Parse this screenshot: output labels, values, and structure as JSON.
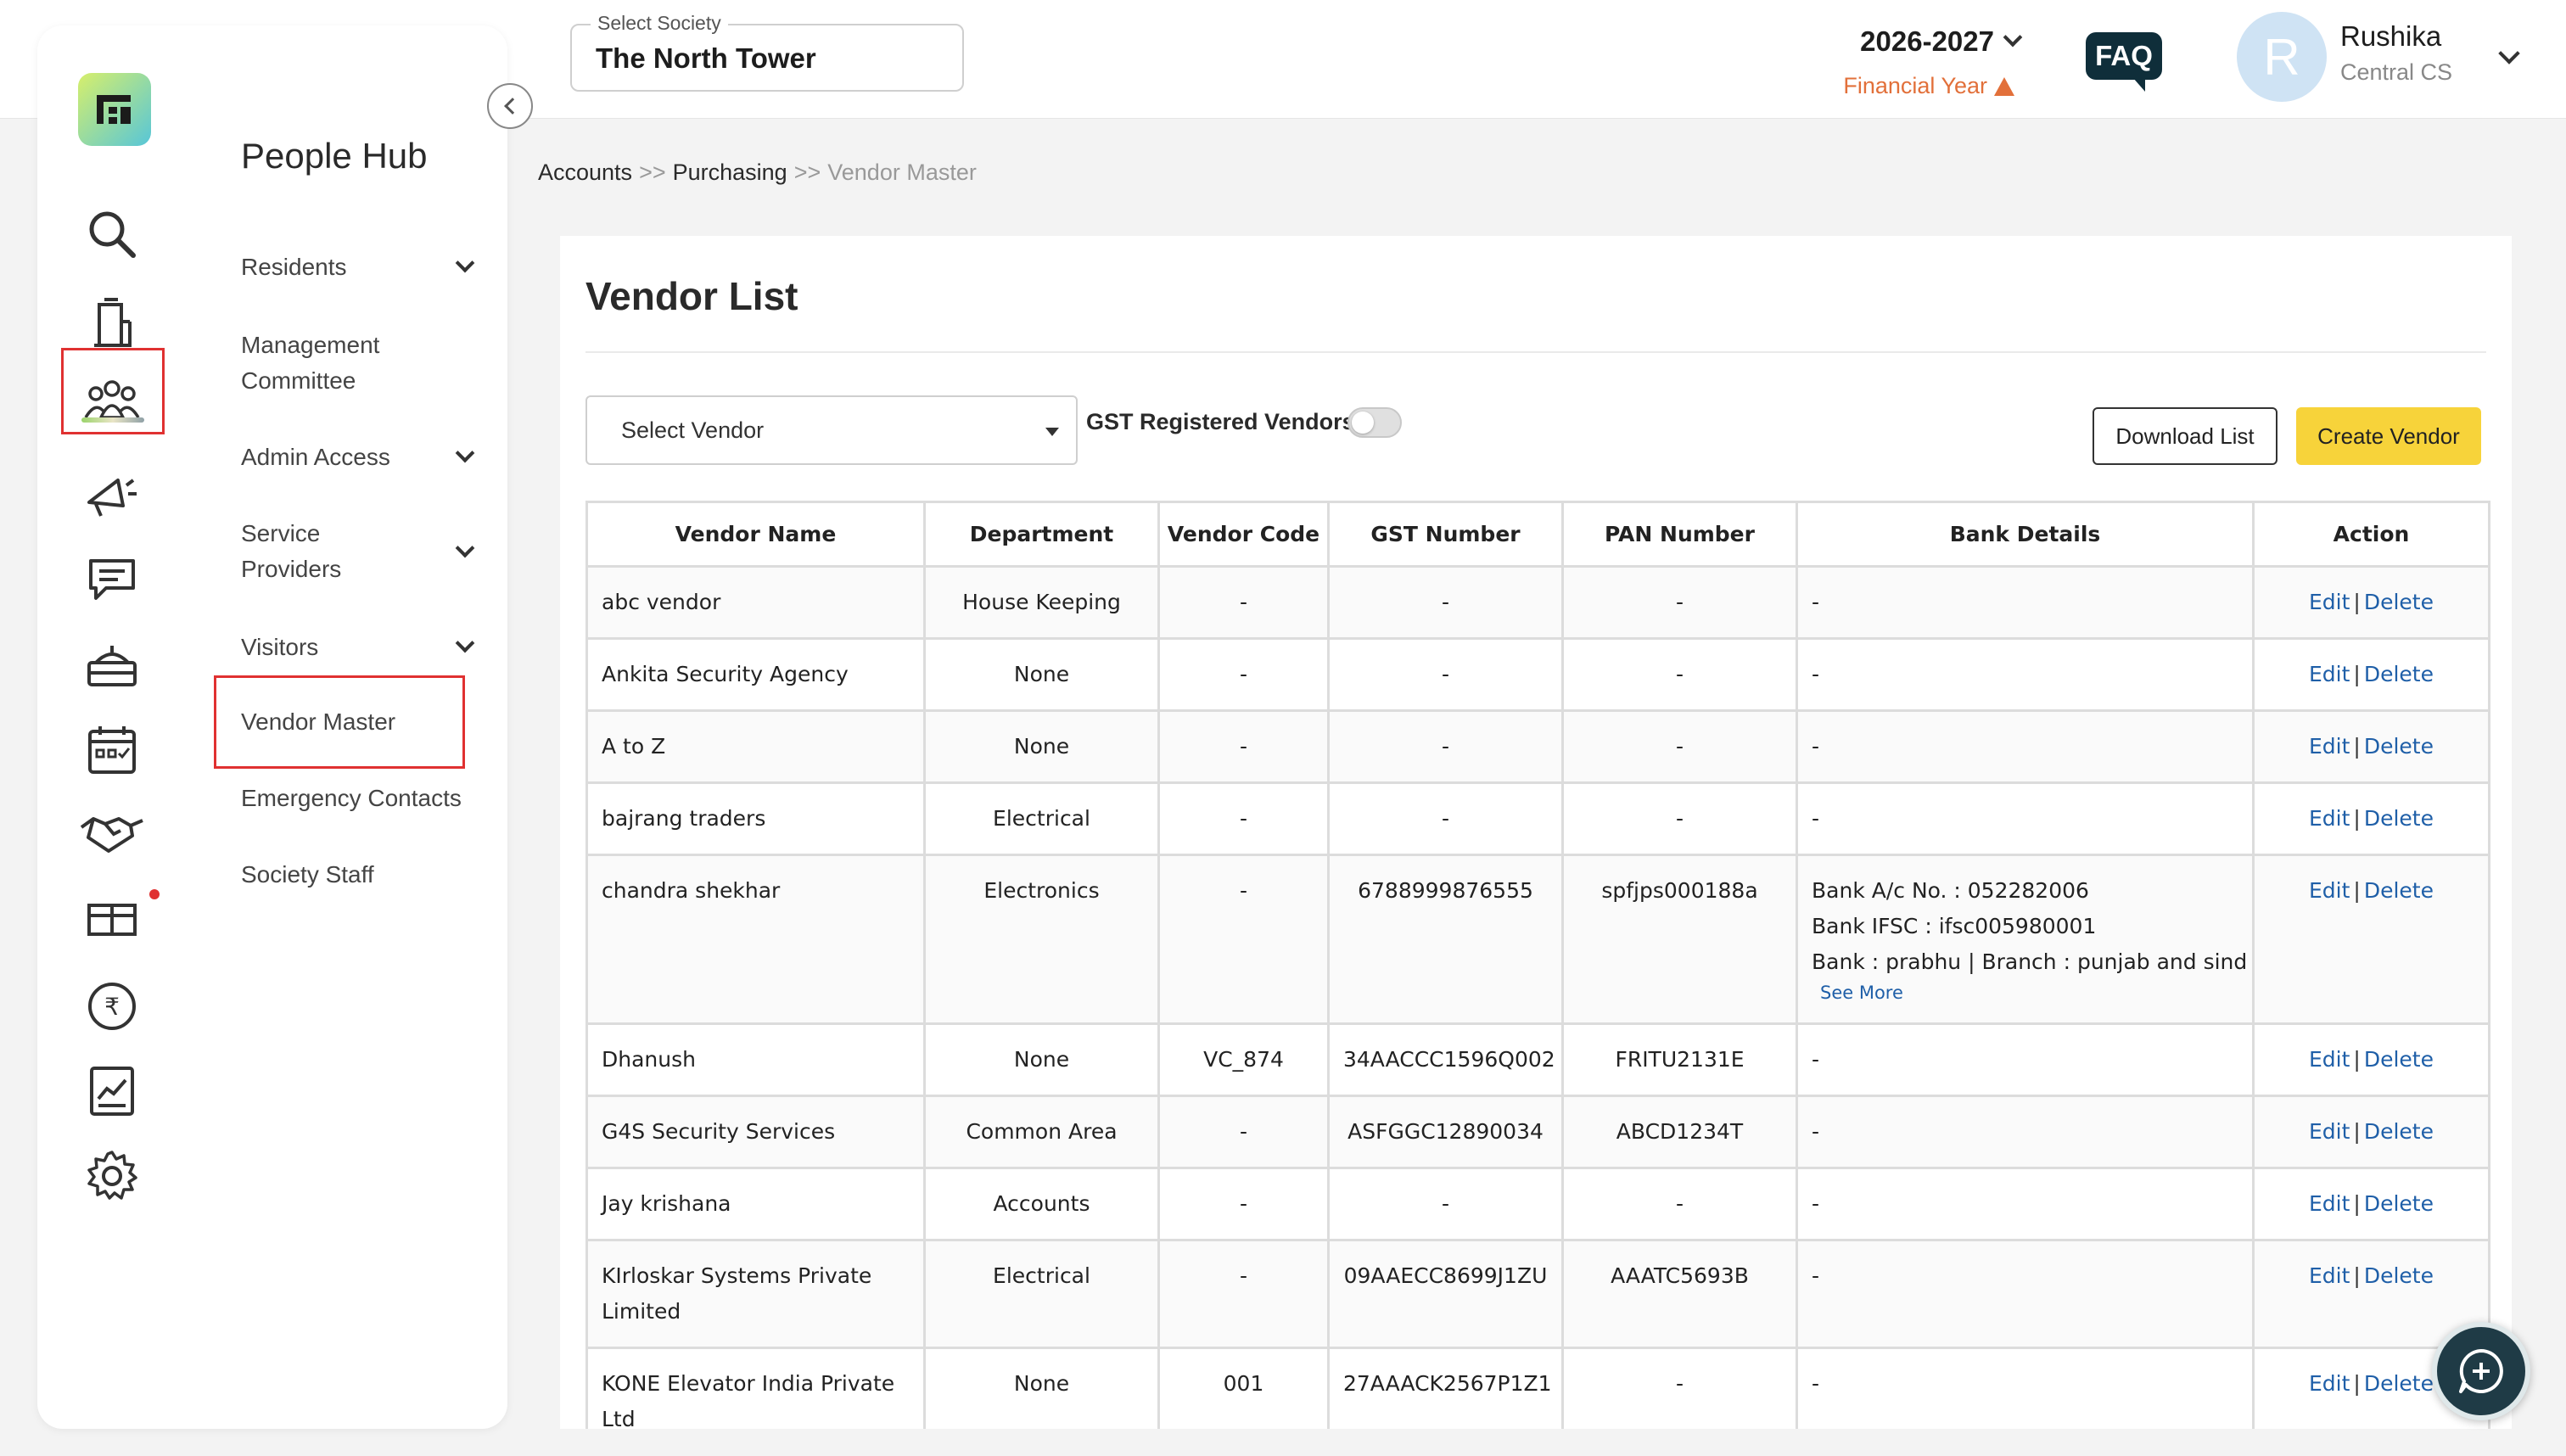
{
  "header": {
    "society_label": "Select Society",
    "society_value": "The North Tower",
    "financial_year": "2026-2027",
    "financial_year_label": "Financial Year",
    "faq": "FAQ",
    "user_initial": "R",
    "user_name": "Rushika",
    "user_role": "Central CS"
  },
  "sidebar": {
    "title": "People Hub",
    "icons": [
      "search-icon",
      "building-icon",
      "people-icon",
      "announcement-icon",
      "chat-icon",
      "amenity-icon",
      "calendar-icon",
      "handshake-icon",
      "parcel-icon",
      "rupee-icon",
      "report-icon",
      "settings-icon"
    ],
    "items": [
      {
        "label": "Residents",
        "expandable": true
      },
      {
        "label": "Management Committee",
        "expandable": false
      },
      {
        "label": "Admin Access",
        "expandable": true
      },
      {
        "label": "Service Providers",
        "expandable": true
      },
      {
        "label": "Visitors",
        "expandable": true
      },
      {
        "label": "Vendor Master",
        "expandable": false,
        "active": true
      },
      {
        "label": "Emergency Contacts",
        "expandable": false
      },
      {
        "label": "Society Staff",
        "expandable": false
      }
    ]
  },
  "breadcrumb": {
    "items": [
      "Accounts",
      "Purchasing",
      "Vendor Master"
    ],
    "separator": ">>"
  },
  "main": {
    "title": "Vendor List",
    "vendor_select": "Select Vendor",
    "gst_toggle_label": "GST Registered Vendors",
    "gst_toggle_on": false,
    "download_button": "Download List",
    "create_button": "Create Vendor",
    "columns": [
      "Vendor Name",
      "Department",
      "Vendor Code",
      "GST Number",
      "PAN Number",
      "Bank Details",
      "Action"
    ],
    "edit_label": "Edit",
    "delete_label": "Delete",
    "see_more": "See More",
    "rows": [
      {
        "name": "abc vendor",
        "dept": "House Keeping",
        "code": "-",
        "gst": "-",
        "pan": "-",
        "bank": [
          "-"
        ]
      },
      {
        "name": "Ankita Security Agency",
        "dept": "None",
        "code": "-",
        "gst": "-",
        "pan": "-",
        "bank": [
          "-"
        ]
      },
      {
        "name": "A to Z",
        "dept": "None",
        "code": "-",
        "gst": "-",
        "pan": "-",
        "bank": [
          "-"
        ]
      },
      {
        "name": "bajrang traders",
        "dept": "Electrical",
        "code": "-",
        "gst": "-",
        "pan": "-",
        "bank": [
          "-"
        ]
      },
      {
        "name": "chandra shekhar",
        "dept": "Electronics",
        "code": "-",
        "gst": "6788999876555",
        "pan": "spfjps000188a",
        "bank": [
          "Bank A/c No. : 052282006",
          "Bank IFSC : ifsc005980001",
          "Bank : prabhu | Branch : punjab and sind ban"
        ],
        "see_more": true
      },
      {
        "name": "Dhanush",
        "dept": "None",
        "code": "VC_874",
        "gst": "34AACCC1596Q002",
        "pan": "FRITU2131E",
        "bank": [
          "-"
        ]
      },
      {
        "name": "G4S Security Services",
        "dept": "Common Area",
        "code": "-",
        "gst": "ASFGGC12890034",
        "pan": "ABCD1234T",
        "bank": [
          "-"
        ]
      },
      {
        "name": "Jay krishana",
        "dept": "Accounts",
        "code": "-",
        "gst": "-",
        "pan": "-",
        "bank": [
          "-"
        ]
      },
      {
        "name": "KIrloskar Systems Private Limited",
        "dept": "Electrical",
        "code": "-",
        "gst": "09AAECC8699J1ZU",
        "pan": "AAATC5693B",
        "bank": [
          "-"
        ]
      },
      {
        "name": "KONE Elevator India Private Ltd",
        "dept": "None",
        "code": "001",
        "gst": "27AAACK2567P1Z1",
        "pan": "-",
        "bank": [
          "-"
        ]
      }
    ]
  },
  "colors": {
    "accent_yellow": "#f7d33a",
    "link_blue": "#1f5fa8",
    "warning_orange": "#e2703a",
    "highlight_red": "#e03131",
    "faq_dark": "#0f2e3a"
  }
}
